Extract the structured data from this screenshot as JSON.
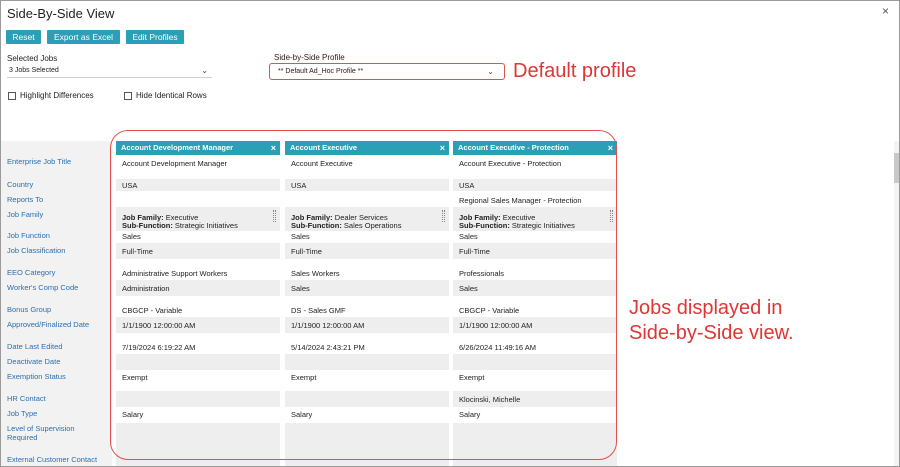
{
  "window": {
    "title": "Side-By-Side View",
    "close_glyph": "×"
  },
  "toolbar": {
    "reset": "Reset",
    "export": "Export as Excel",
    "edit": "Edit Profiles"
  },
  "selected_jobs": {
    "label": "Selected Jobs",
    "value": "3 Jobs Selected"
  },
  "profile": {
    "label": "Side-by-Side Profile",
    "value": "** Default Ad_Hoc Profile **"
  },
  "options": {
    "highlight": "Highlight Differences",
    "hide_identical": "Hide Identical Rows"
  },
  "annotations": {
    "profile_note": "Default profile",
    "jobs_note_line1": "Jobs displayed in",
    "jobs_note_line2": "Side-by-Side view."
  },
  "fields": [
    "Enterprise Job Title",
    "Country",
    "Reports To",
    "Job Family",
    "Job Function",
    "Job Classification",
    "EEO Category",
    "Worker's Comp Code",
    "Bonus Group",
    "Approved/Finalized Date",
    "Date Last Edited",
    "Deactivate Date",
    "Exemption Status",
    "HR Contact",
    "Job Type",
    "Level of Supervision Required",
    "External Customer Contact"
  ],
  "jobs": [
    {
      "header": "Account Development Manager",
      "title": "Account Development Manager",
      "country": "USA",
      "reports_to": "",
      "job_family_label": "Job Family:",
      "job_family_value": " Executive",
      "sub_function_label": "Sub-Function:",
      "sub_function_value": " Strategic Initiatives",
      "job_function": "Sales",
      "classification": "Full-Time",
      "eeo": "Administrative Support Workers",
      "comp_code": "Administration",
      "bonus": "CBGCP - Variable",
      "approved": "1/1/1900 12:00:00 AM",
      "edited": "7/19/2024 6:19:22 AM",
      "deactivate": "",
      "exemption": "Exempt",
      "hr_contact": "",
      "job_type": "Salary"
    },
    {
      "header": "Account Executive",
      "title": "Account Executive",
      "country": "USA",
      "reports_to": "",
      "job_family_label": "Job Family:",
      "job_family_value": " Dealer Services",
      "sub_function_label": "Sub-Function:",
      "sub_function_value": " Sales Operations",
      "job_function": "Sales",
      "classification": "Full-Time",
      "eeo": "Sales Workers",
      "comp_code": "Sales",
      "bonus": "DS - Sales GMF",
      "approved": "1/1/1900 12:00:00 AM",
      "edited": "5/14/2024 2:43:21 PM",
      "deactivate": "",
      "exemption": "Exempt",
      "hr_contact": "",
      "job_type": "Salary"
    },
    {
      "header": "Account Executive - Protection",
      "title": "Account Executive - Protection",
      "country": "USA",
      "reports_to": "Regional Sales Manager - Protection",
      "job_family_label": "Job Family:",
      "job_family_value": " Executive",
      "sub_function_label": "Sub-Function:",
      "sub_function_value": " Strategic Initiatives",
      "job_function": "Sales",
      "classification": "Full-Time",
      "eeo": "Professionals",
      "comp_code": "Sales",
      "bonus": "CBGCP - Variable",
      "approved": "1/1/1900 12:00:00 AM",
      "edited": "6/26/2024 11:49:16 AM",
      "deactivate": "",
      "exemption": "Exempt",
      "hr_contact": "Klocinski, Michelle",
      "job_type": "Salary"
    }
  ]
}
